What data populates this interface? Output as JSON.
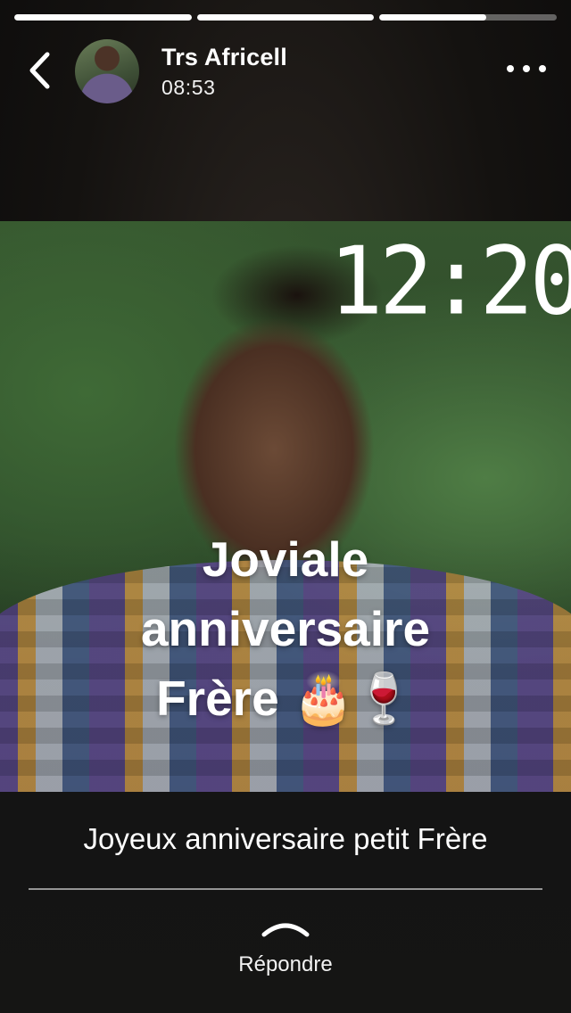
{
  "progress": [
    {
      "fill": 1.0
    },
    {
      "fill": 1.0
    },
    {
      "fill": 0.6
    }
  ],
  "header": {
    "name": "Trs Africell",
    "time": "08:53",
    "back_icon": "chevron-left-icon",
    "more_icon": "more-horizontal-icon"
  },
  "story": {
    "clock": "12:20",
    "overlay_lines": [
      "Joviale",
      "anniversaire",
      "Frère 🎂🍷"
    ]
  },
  "footer": {
    "message": "Joyeux anniversaire petit Frère",
    "reply_label": "Répondre",
    "reply_icon": "chevron-up-icon"
  }
}
